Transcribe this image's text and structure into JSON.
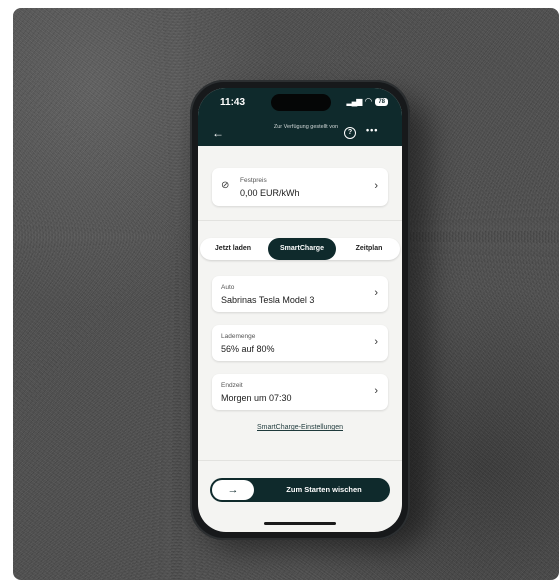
{
  "status": {
    "time": "11:43",
    "battery": "78"
  },
  "header": {
    "subtitle": "Zur Verfügung gestellt von",
    "back_icon": "arrow-left-icon",
    "help_icon": "question-circle-icon",
    "more_icon": "more-dots-icon"
  },
  "price": {
    "label": "Festpreis",
    "value": "0,00 EUR/kWh"
  },
  "tabs": [
    {
      "label": "Jetzt laden",
      "active": false
    },
    {
      "label": "SmartCharge",
      "active": true
    },
    {
      "label": "Zeitplan",
      "active": false
    }
  ],
  "settings": {
    "auto": {
      "label": "Auto",
      "value": "Sabrinas Tesla Model 3"
    },
    "lademenge": {
      "label": "Lademenge",
      "value": "56% auf 80%"
    },
    "endzeit": {
      "label": "Endzeit",
      "value": "Morgen um 07:30"
    }
  },
  "link_label": "SmartCharge-Einstellungen",
  "swipe": {
    "label": "Zum Starten wischen"
  },
  "colors": {
    "brand_dark": "#0f2a2c",
    "screen_bg": "#f4f4f2"
  }
}
